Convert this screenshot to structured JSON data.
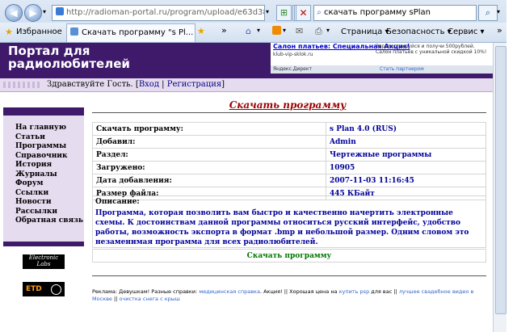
{
  "browser": {
    "url": "http://radioman-portal.ru/program/upload/e63d38a7d826",
    "search_value": "скачать программу sPlan",
    "favorites_label": "Избранное",
    "tab_title": "Скачать программу \"s Pl...",
    "menu": [
      "Страница",
      "Безопасность",
      "Сервис"
    ]
  },
  "site": {
    "title": "Портал для радиолюбителей",
    "greeting": "Здравствуйте Гость.",
    "login_label": "Вход",
    "register_label": "Регистрация",
    "ad": {
      "title": "Салон платьев: Специальная Акция!",
      "text": "Зарегистрируйся и получи 500рублей. Салон платьев с уникальной скидкой 10%!",
      "site": "klub-vip-sklok.ru",
      "yandex": "Яндекс.Директ",
      "partner": "Стать партнером"
    }
  },
  "sidebar": {
    "items": [
      "На главную",
      "Статьи",
      "Программы",
      "Справочник",
      "История",
      "Журналы",
      "Форум",
      "Ссылки",
      "Новости",
      "Рассылки",
      "Обратная связь"
    ]
  },
  "logos": {
    "electronic": "Electronic Labs",
    "etd": "ETD"
  },
  "main": {
    "title": "Скачать программу",
    "rows": [
      {
        "key": "Скачать программу:",
        "value": "s Plan 4.0 (RUS)"
      },
      {
        "key": "Добавил:",
        "value": "Admin"
      },
      {
        "key": "Раздел:",
        "value": "Чертежные программы"
      },
      {
        "key": "Загружено:",
        "value": "10905"
      },
      {
        "key": "Дата добавления:",
        "value": "2007-11-03 11:16:45"
      },
      {
        "key": "Размер файла:",
        "value": "445 КБайт"
      }
    ],
    "description_label": "Описание:",
    "description": "Программа, которая позволить вам быстро и качественно начертить электронные схемы. К достоинствам данной программы относиться русский интерфейс, удобство работы, возможность экспорта в формат .bmp и небольшой размер. Одним словом это незаменимая программа для всех радиолюбителей.",
    "download_label": "Скачать программу"
  },
  "footer": {
    "prefix": "Реклама: Девушкам! Разные справки:",
    "link1": "медицинская справка",
    "mid1": ". Акция! || Хорошая цена на",
    "link2": "купить psp",
    "mid2": "для вас || ",
    "link3": "лучшее свадебное видео в Москве",
    "mid3": " || ",
    "link4": "очистка снега с крыш"
  }
}
